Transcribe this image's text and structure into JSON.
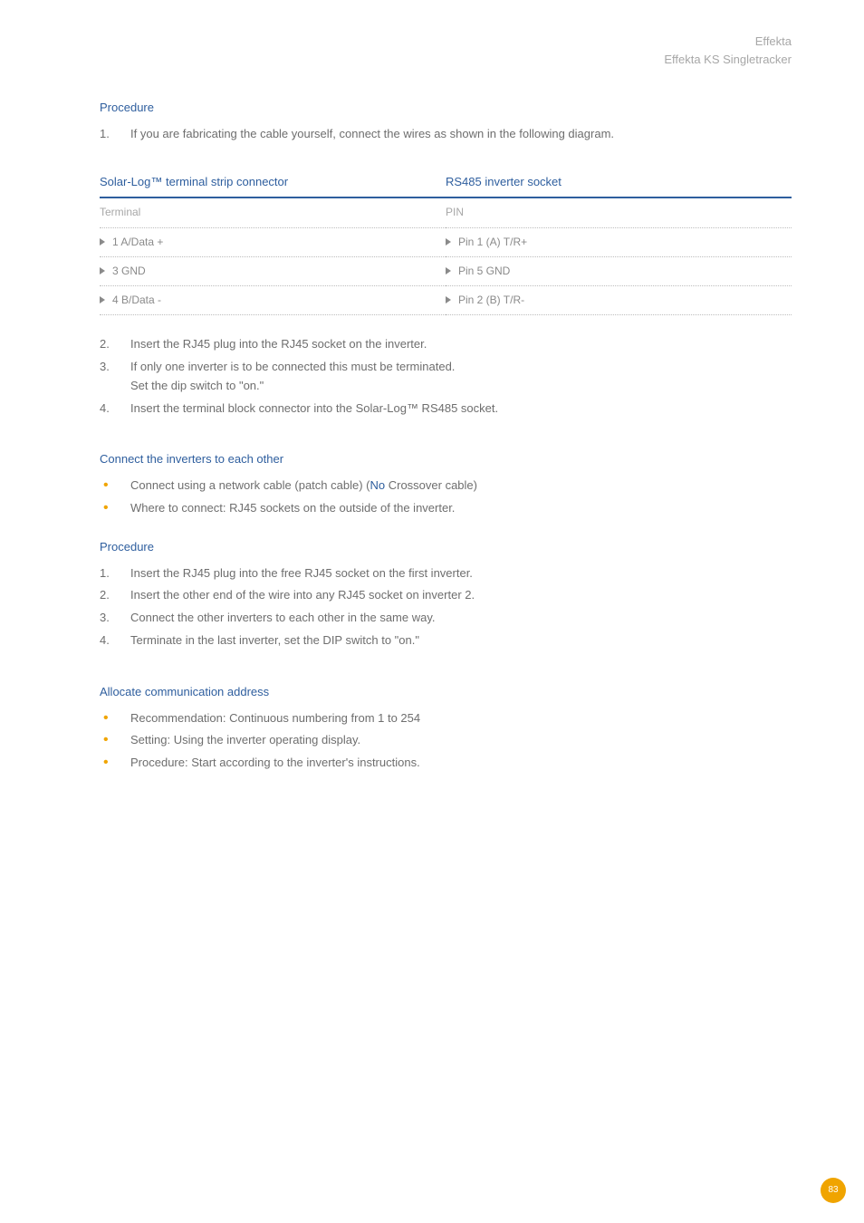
{
  "header": {
    "line1": "Effekta",
    "line2": "Effekta KS Singletracker"
  },
  "procedure1": {
    "title": "Procedure",
    "steps": [
      "If you are fabricating the cable yourself, connect the wires as shown in the following diagram."
    ]
  },
  "table": {
    "col1_title": "Solar-Log™ terminal strip connector",
    "col2_title": "RS485 inverter socket",
    "sub1": "Terminal",
    "sub2": "PIN",
    "rows": [
      {
        "left": "1 A/Data +",
        "right": "Pin 1 (A) T/R+"
      },
      {
        "left": "3 GND",
        "right": "Pin 5 GND"
      },
      {
        "left": "4 B/Data -",
        "right": "Pin 2 (B) T/R-"
      }
    ]
  },
  "procedure1b": {
    "steps": [
      "Insert the RJ45 plug into the RJ45 socket on the inverter.",
      "If only one inverter is to be connected this must be terminated.\nSet the dip switch to \"on.\"",
      "Insert the terminal block connector into the Solar-Log™ RS485 socket."
    ]
  },
  "connect": {
    "title": "Connect the inverters to each other",
    "bullets": [
      {
        "pre": "Connect using a network cable (patch cable) (",
        "bold": "No",
        "post": " Crossover cable)"
      },
      {
        "pre": "Where to connect: RJ45 sockets on the outside of the inverter.",
        "bold": "",
        "post": ""
      }
    ]
  },
  "procedure2": {
    "title": "Procedure",
    "steps": [
      "Insert the RJ45 plug into the free RJ45 socket on the first inverter.",
      "Insert the other end of the wire into any RJ45 socket on inverter 2.",
      "Connect the other inverters to each other in the same way.",
      "Terminate in the last inverter, set the DIP switch to \"on.\""
    ]
  },
  "allocate": {
    "title": "Allocate communication address",
    "bullets": [
      "Recommendation: Continuous numbering from 1 to 254",
      "Setting: Using the inverter operating display.",
      "Procedure: Start according to the inverter's instructions."
    ]
  },
  "page_number": "83"
}
